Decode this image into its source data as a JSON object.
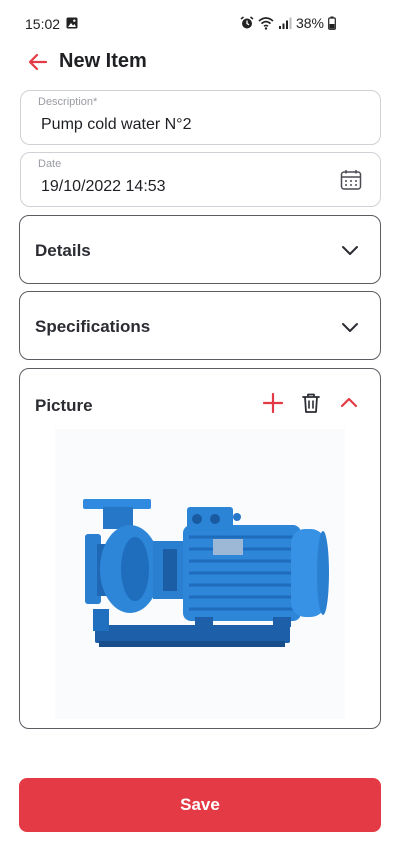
{
  "status_bar": {
    "time": "15:02",
    "battery": "38%"
  },
  "header": {
    "title": "New Item"
  },
  "form": {
    "description": {
      "label": "Description*",
      "value": "Pump cold water N°2"
    },
    "date": {
      "label": "Date",
      "value": "19/10/2022 14:53"
    }
  },
  "sections": {
    "details": {
      "title": "Details",
      "expanded": false
    },
    "specifications": {
      "title": "Specifications",
      "expanded": false
    },
    "picture": {
      "title": "Picture",
      "expanded": true
    }
  },
  "colors": {
    "accent": "#e43a45",
    "pump_blue": "#2d86d8"
  },
  "icons": [
    "back-arrow-icon",
    "calendar-icon",
    "chevron-down-icon",
    "plus-icon",
    "trash-icon",
    "chevron-up-icon"
  ],
  "actions": {
    "save_label": "Save"
  }
}
